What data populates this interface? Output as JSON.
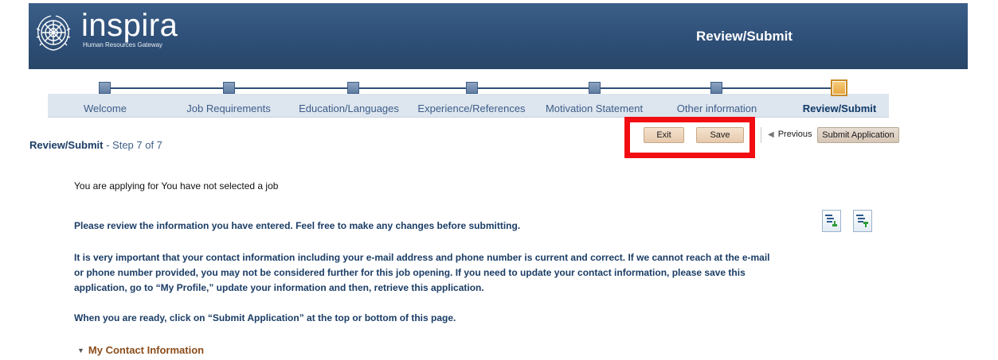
{
  "header": {
    "logo_main": "inspira",
    "logo_sub": "Human Resources Gateway",
    "title": "Review/Submit"
  },
  "stepper": {
    "steps": [
      {
        "label": "Welcome",
        "active": false
      },
      {
        "label": "Job Requirements",
        "active": false
      },
      {
        "label": "Education/Languages",
        "active": false
      },
      {
        "label": "Experience/References",
        "active": false
      },
      {
        "label": "Motivation Statement",
        "active": false
      },
      {
        "label": "Other information",
        "active": false
      },
      {
        "label": "Review/Submit",
        "active": true
      }
    ]
  },
  "actions": {
    "exit_label": "Exit",
    "save_label": "Save",
    "previous_label": "Previous",
    "submit_label": "Submit Application"
  },
  "page": {
    "title": "Review/Submit",
    "step_text": "- Step 7 of 7",
    "applying_text": "You are applying for  You have not selected a job",
    "review_text": "Please review the information you have entered. Feel free to make any changes before submitting.",
    "contact_text": "It is very important that your contact information including your e-mail address and phone number is current and correct. If we cannot reach at the e-mail or phone number provided, you may not be considered further for this job opening. If you need to update your contact information, please save this application, go to “My Profile,” update your information and then, retrieve this application.",
    "ready_text": "When you are ready, click on “Submit Application” at the top or bottom of this page.",
    "section_title": "My Contact Information"
  },
  "icons": {
    "expand_all": "expand-all-icon",
    "collapse_all": "collapse-all-icon",
    "highlight_color": "#f20d12",
    "brand_color": "#2e4f77"
  }
}
